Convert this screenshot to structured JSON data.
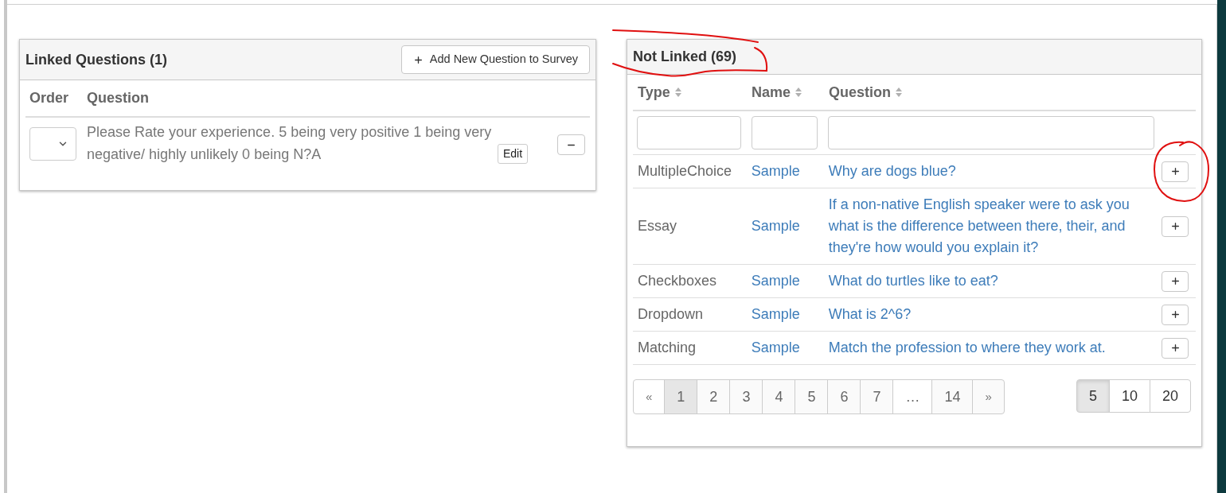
{
  "linked_questions": {
    "title": "Linked Questions (1)",
    "add_button": "Add New Question to Survey",
    "columns": [
      "Order",
      "Question"
    ],
    "rows": [
      {
        "question": "Please Rate your experience. 5 being very positive 1 being very negative/ highly unlikely 0 being N?A",
        "edit_label": "Edit"
      }
    ]
  },
  "not_linked": {
    "title": "Not Linked (69)",
    "circled": true,
    "columns": [
      {
        "label": "Type",
        "sortable": true
      },
      {
        "label": "Name",
        "sortable": true
      },
      {
        "label": "Question",
        "sortable": true
      }
    ],
    "rows": [
      {
        "type": "MultipleChoice",
        "name": "Sample",
        "question": "Why are dogs blue?",
        "circled": true
      },
      {
        "type": "Essay",
        "name": "Sample",
        "question": "If a non-native English speaker were to ask you what is the difference between there, their, and they're how would you explain it?",
        "circled": false
      },
      {
        "type": "Checkboxes",
        "name": "Sample",
        "question": "What do turtles like to eat?",
        "circled": false
      },
      {
        "type": "Dropdown",
        "name": "Sample",
        "question": "What is 2^6?",
        "circled": false
      },
      {
        "type": "Matching",
        "name": "Sample",
        "question": "Match the profession to where they work at.",
        "circled": false
      }
    ],
    "pagination": [
      {
        "label": "«",
        "kind": "prev",
        "selected": false
      },
      {
        "label": "1",
        "kind": "page",
        "selected": true
      },
      {
        "label": "2",
        "kind": "page",
        "selected": false
      },
      {
        "label": "3",
        "kind": "page",
        "selected": false
      },
      {
        "label": "4",
        "kind": "page",
        "selected": false
      },
      {
        "label": "5",
        "kind": "page",
        "selected": false
      },
      {
        "label": "6",
        "kind": "page",
        "selected": false
      },
      {
        "label": "7",
        "kind": "page",
        "selected": false
      },
      {
        "label": "…",
        "kind": "ellipsis",
        "selected": false
      },
      {
        "label": "14",
        "kind": "page",
        "selected": false
      },
      {
        "label": "»",
        "kind": "next",
        "selected": false
      }
    ],
    "page_sizes": [
      {
        "label": "5",
        "selected": true
      },
      {
        "label": "10",
        "selected": false
      },
      {
        "label": "20",
        "selected": false
      }
    ]
  }
}
